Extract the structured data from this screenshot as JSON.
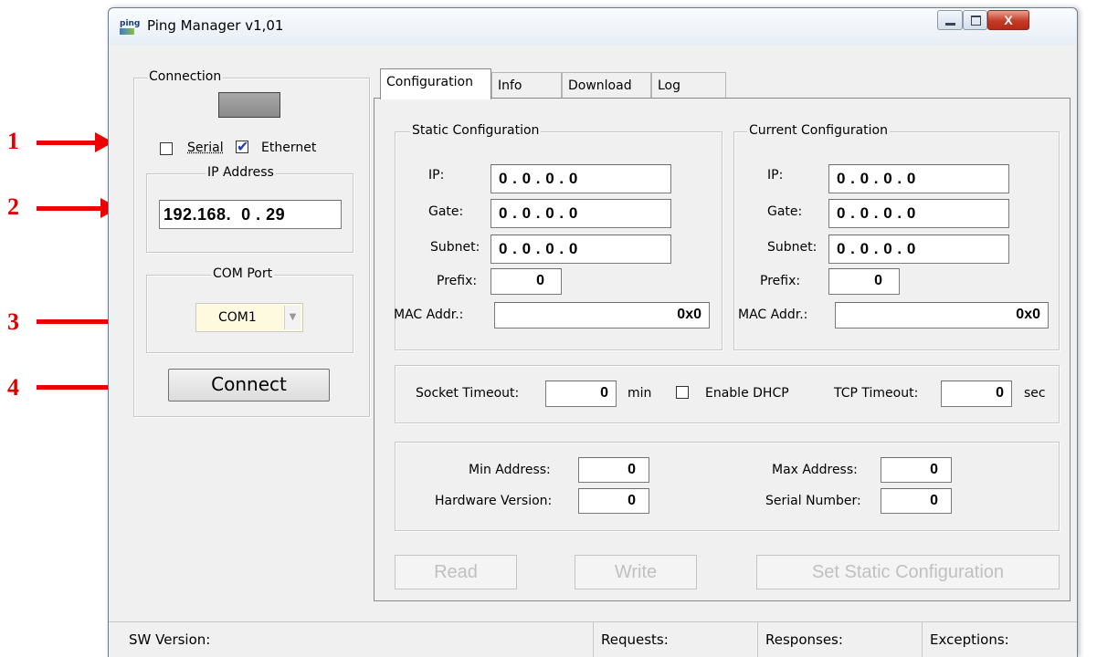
{
  "annotations": [
    "1",
    "2",
    "3",
    "4"
  ],
  "window": {
    "title": "Ping Manager v1,01",
    "icon_text": "ping",
    "controls": {
      "minimize": "minimize-icon",
      "maximize": "maximize-icon",
      "close": "X"
    }
  },
  "connection": {
    "group_label": "Connection",
    "serial_label": "Serial",
    "serial_checked": false,
    "ethernet_label": "Ethernet",
    "ethernet_checked": true,
    "ip_group_label": "IP Address",
    "ip_value": "192.168.  0 . 29",
    "com_group_label": "COM Port",
    "com_value": "COM1",
    "connect_label": "Connect"
  },
  "tabs": [
    {
      "label": "Configuration",
      "active": true
    },
    {
      "label": "Info",
      "active": false
    },
    {
      "label": "Download",
      "active": false
    },
    {
      "label": "Log",
      "active": false
    }
  ],
  "static_config": {
    "title": "Static Configuration",
    "ip_label": "IP:",
    "ip": "0 . 0 . 0 . 0",
    "gate_label": "Gate:",
    "gate": "0 . 0 . 0 . 0",
    "subnet_label": "Subnet:",
    "subnet": "0 . 0 . 0 . 0",
    "prefix_label": "Prefix:",
    "prefix": "0",
    "mac_label": "MAC Addr.:",
    "mac": "0x0"
  },
  "current_config": {
    "title": "Current Configuration",
    "ip_label": "IP:",
    "ip": "0 . 0 . 0 . 0",
    "gate_label": "Gate:",
    "gate": "0 . 0 . 0 . 0",
    "subnet_label": "Subnet:",
    "subnet": "0 . 0 . 0 . 0",
    "prefix_label": "Prefix:",
    "prefix": "0",
    "mac_label": "MAC Addr.:",
    "mac": "0x0"
  },
  "timeouts": {
    "socket_label": "Socket Timeout:",
    "socket_value": "0",
    "socket_unit": "min",
    "dhcp_label": "Enable DHCP",
    "dhcp_checked": false,
    "tcp_label": "TCP Timeout:",
    "tcp_value": "0",
    "tcp_unit": "sec"
  },
  "device": {
    "min_address_label": "Min Address:",
    "min_address": "0",
    "max_address_label": "Max Address:",
    "max_address": "0",
    "hw_version_label": "Hardware Version:",
    "hw_version": "0",
    "serial_number_label": "Serial Number:",
    "serial_number": "0"
  },
  "actions": {
    "read": "Read",
    "write": "Write",
    "set_static": "Set Static Configuration"
  },
  "status_bar": {
    "sw_version": "SW Version:",
    "requests": "Requests:",
    "responses": "Responses:",
    "exceptions": "Exceptions:"
  }
}
